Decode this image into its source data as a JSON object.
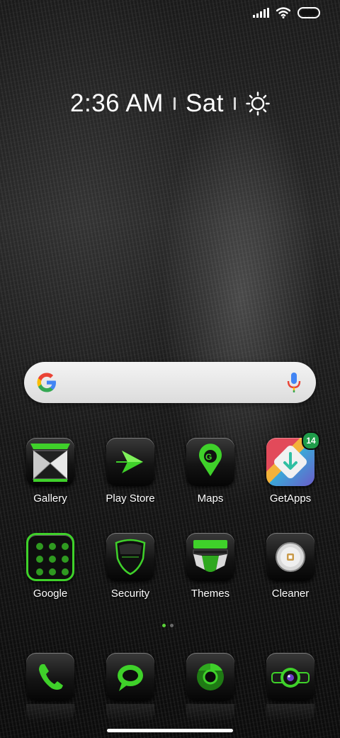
{
  "status_bar": {
    "icons": [
      "signal-icon",
      "wifi-icon",
      "battery-icon"
    ]
  },
  "clock_widget": {
    "time": "2:36 AM",
    "day": "Sat",
    "weather_icon": "sun-icon"
  },
  "search_bar": {
    "logo": "google-g-icon",
    "mic": "mic-icon"
  },
  "apps": [
    {
      "label": "Gallery",
      "icon": "gallery-icon"
    },
    {
      "label": "Play Store",
      "icon": "play-store-icon"
    },
    {
      "label": "Maps",
      "icon": "maps-icon"
    },
    {
      "label": "GetApps",
      "icon": "getapps-icon",
      "badge": "14"
    },
    {
      "label": "Google",
      "icon": "google-folder-icon"
    },
    {
      "label": "Security",
      "icon": "security-icon"
    },
    {
      "label": "Themes",
      "icon": "themes-icon"
    },
    {
      "label": "Cleaner",
      "icon": "cleaner-icon"
    }
  ],
  "dock": [
    {
      "icon": "phone-icon"
    },
    {
      "icon": "messages-icon"
    },
    {
      "icon": "chrome-icon"
    },
    {
      "icon": "camera-icon"
    }
  ],
  "page_indicator": {
    "pages": 2,
    "active": 1
  },
  "colors": {
    "accent": "#3fd12a",
    "badge": "#1f9c4a"
  }
}
